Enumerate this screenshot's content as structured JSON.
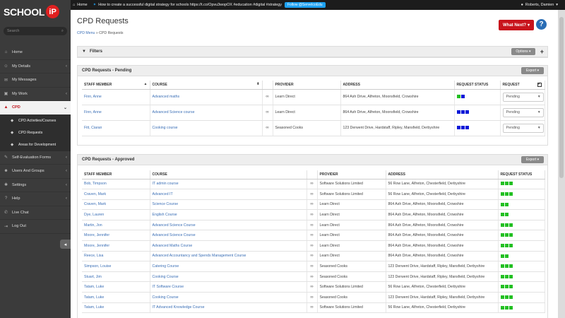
{
  "topbar": {
    "home": "Home",
    "tweet": "How to create a successful digital strategy for schools https://t.co/Opvu3wopOX #education #digital #strategy",
    "follow": "Follow @ServeIcoEdu",
    "user": "Roberts, Damien"
  },
  "sidebar": {
    "logo": "SCHOOL",
    "logo_badge": "iP",
    "search_placeholder": "Search",
    "items": [
      {
        "label": "Home",
        "icon": "home-icon"
      },
      {
        "label": "My Details",
        "icon": "user-icon"
      },
      {
        "label": "My Messages",
        "icon": "envelope-icon"
      },
      {
        "label": "My Work",
        "icon": "briefcase-icon"
      },
      {
        "label": "CPD",
        "icon": "graduation-cap-icon"
      },
      {
        "label": "Self-Evaluation Forms",
        "icon": "pencil-icon"
      },
      {
        "label": "Users And Groups",
        "icon": "users-icon"
      },
      {
        "label": "Settings",
        "icon": "wrench-icon"
      },
      {
        "label": "Help",
        "icon": "question-icon"
      },
      {
        "label": "Live Chat",
        "icon": "chat-icon"
      },
      {
        "label": "Log Out",
        "icon": "logout-icon"
      }
    ],
    "cpd_sub": [
      {
        "label": "CPD Activities/Courses"
      },
      {
        "label": "CPD Requests"
      },
      {
        "label": "Areas for Development"
      }
    ]
  },
  "page": {
    "title": "CPD Requests",
    "breadcrumb_link": "CPD Menu",
    "breadcrumb_sep": "»",
    "breadcrumb_current": "CPD Requests",
    "what_next": "What Next?",
    "help": "?"
  },
  "filters": {
    "title": "Filters",
    "options": "Options ▾",
    "add": "+"
  },
  "pending": {
    "title": "CPD Requests - Pending",
    "export": "Export ▾",
    "headers": [
      "STAFF MEMBER",
      "COURSE",
      "",
      "PROVIDER",
      "ADDRESS",
      "REQUEST STATUS",
      "REQUEST"
    ],
    "rows": [
      {
        "staff": "Finn, Anne",
        "course": "Advanced maths",
        "provider": "Learn Direct",
        "address": "864 Ash Drive, Alfreton, Moonsfield, Crowshire",
        "status": [
          "#22c022",
          "#0a18d8"
        ],
        "request": "Pending"
      },
      {
        "staff": "Finn, Anne",
        "course": "Advanced Science course",
        "provider": "Learn Direct",
        "address": "864 Ash Drive, Alfreton, Moonsfield, Crowshire",
        "status": [
          "#0a18d8",
          "#0a18d8",
          "#0a18d8"
        ],
        "request": "Pending"
      },
      {
        "staff": "Fitt, Ciaran",
        "course": "Cooking course",
        "provider": "Seasoned Cooks",
        "address": "123 Derwent Drive, Hardstaff, Ripley, Mansfield, Derbyshire",
        "status": [
          "#0a18d8",
          "#0a18d8",
          "#0a18d8"
        ],
        "request": "Pending"
      }
    ]
  },
  "approved": {
    "title": "CPD Requests - Approved",
    "export": "Export ▾",
    "headers": [
      "STAFF MEMBER",
      "COURSE",
      "",
      "PROVIDER",
      "ADDRESS",
      "REQUEST STATUS"
    ],
    "rows": [
      {
        "staff": "Bob, Timpson",
        "course": "IT admin course",
        "provider": "Software Solutions Limited",
        "address": "56 Row Lane, Alfreton, Chesterfield, Derbyshire",
        "status": 3
      },
      {
        "staff": "Craven, Mark",
        "course": "Advanced IT",
        "provider": "Software Solutions Limited",
        "address": "56 Row Lane, Alfreton, Chesterfield, Derbyshire",
        "status": 3
      },
      {
        "staff": "Craven, Mark",
        "course": "Science Course",
        "provider": "Learn Direct",
        "address": "864 Ash Drive, Alfreton, Moonsfield, Crowshire",
        "status": 2
      },
      {
        "staff": "Dye, Lauren",
        "course": "English Course",
        "provider": "Learn Direct",
        "address": "864 Ash Drive, Alfreton, Moonsfield, Crowshire",
        "status": 2
      },
      {
        "staff": "Martin, Jon",
        "course": "Advanced Science Course",
        "provider": "Learn Direct",
        "address": "864 Ash Drive, Alfreton, Moonsfield, Crowshire",
        "status": 3
      },
      {
        "staff": "Moore, Jennifer",
        "course": "Advanced Science Course",
        "provider": "Learn Direct",
        "address": "864 Ash Drive, Alfreton, Moonsfield, Crowshire",
        "status": 3
      },
      {
        "staff": "Moore, Jennifer",
        "course": "Advanced Maths Course",
        "provider": "Learn Direct",
        "address": "864 Ash Drive, Alfreton, Moonsfield, Crowshire",
        "status": 3
      },
      {
        "staff": "Reece, Lisa",
        "course": "Advanced Accountancy and Spends Management Course",
        "provider": "Learn Direct",
        "address": "864 Ash Drive, Alfreton, Moonsfield, Crowshire",
        "status": 2
      },
      {
        "staff": "Simpson, Louise",
        "course": "Catering Course",
        "provider": "Seasoned Cooks",
        "address": "123 Derwent Drive, Hardstaff, Ripley, Mansfield, Derbyshire",
        "status": 3
      },
      {
        "staff": "Stuart, Jim",
        "course": "Cooking Course",
        "provider": "Seasoned Cooks",
        "address": "123 Derwent Drive, Hardstaff, Ripley, Mansfield, Derbyshire",
        "status": 3
      },
      {
        "staff": "Tatam, Luke",
        "course": "IT Software Course",
        "provider": "Software Solutions Limited",
        "address": "56 Row Lane, Alfreton, Chesterfield, Derbyshire",
        "status": 3
      },
      {
        "staff": "Tatam, Luke",
        "course": "Cooking Course",
        "provider": "Seasoned Cooks",
        "address": "123 Derwent Drive, Hardstaff, Ripley, Mansfield, Derbyshire",
        "status": 3
      },
      {
        "staff": "Tatam, Luke",
        "course": "IT Advanced Knowledge Course",
        "provider": "Software Solutions Limited",
        "address": "56 Row Lane, Alfreton, Chesterfield, Derbyshire",
        "status": 3
      }
    ]
  },
  "colors": {
    "brand_red": "#c8141c",
    "link": "#3b6fb6",
    "status_green": "#22c022",
    "status_blue": "#0a18d8"
  }
}
